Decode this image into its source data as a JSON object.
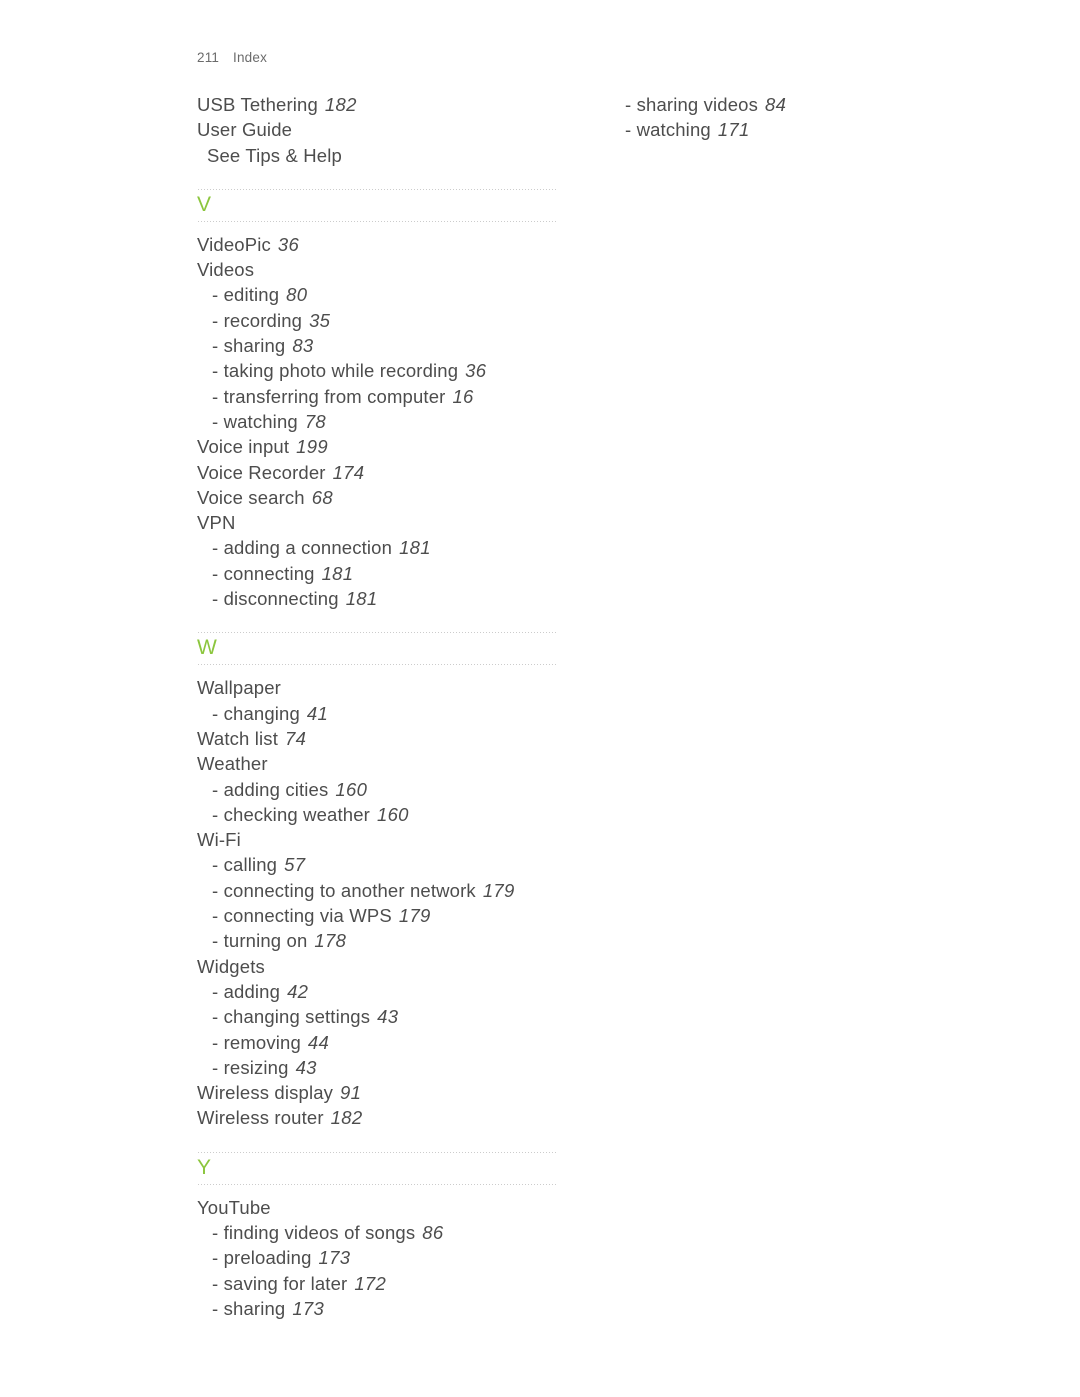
{
  "document": {
    "type": "index",
    "page_number": "211",
    "section_name": "Index",
    "accent_color": "#8cc63e",
    "text_color": "#4d4d4d",
    "background_color": "#ffffff"
  },
  "columns": [
    {
      "id": "left-column",
      "blocks": [
        {
          "kind": "entries",
          "entries": [
            {
              "level": 1,
              "term": "USB Tethering",
              "page": "182"
            },
            {
              "level": 1,
              "term": "User Guide",
              "page": ""
            },
            {
              "level": 1,
              "style": "xref",
              "term": "See Tips & Help",
              "page": ""
            }
          ]
        },
        {
          "kind": "alpha",
          "letter": "V"
        },
        {
          "kind": "entries",
          "entries": [
            {
              "level": 1,
              "term": "VideoPic",
              "page": "36"
            },
            {
              "level": 1,
              "term": "Videos",
              "page": ""
            },
            {
              "level": 2,
              "term": "- editing",
              "page": "80"
            },
            {
              "level": 2,
              "term": "- recording",
              "page": "35"
            },
            {
              "level": 2,
              "term": "- sharing",
              "page": "83"
            },
            {
              "level": 2,
              "term": "- taking photo while recording",
              "page": "36"
            },
            {
              "level": 2,
              "term": "- transferring from computer",
              "page": "16"
            },
            {
              "level": 2,
              "term": "- watching",
              "page": "78"
            },
            {
              "level": 1,
              "term": "Voice input",
              "page": "199"
            },
            {
              "level": 1,
              "term": "Voice Recorder",
              "page": "174"
            },
            {
              "level": 1,
              "term": "Voice search",
              "page": "68"
            },
            {
              "level": 1,
              "term": "VPN",
              "page": ""
            },
            {
              "level": 2,
              "term": "- adding a connection",
              "page": "181"
            },
            {
              "level": 2,
              "term": "- connecting",
              "page": "181"
            },
            {
              "level": 2,
              "term": "- disconnecting",
              "page": "181"
            }
          ]
        },
        {
          "kind": "alpha",
          "letter": "W"
        },
        {
          "kind": "entries",
          "entries": [
            {
              "level": 1,
              "term": "Wallpaper",
              "page": ""
            },
            {
              "level": 2,
              "term": "- changing",
              "page": "41"
            },
            {
              "level": 1,
              "term": "Watch list",
              "page": "74"
            },
            {
              "level": 1,
              "term": "Weather",
              "page": ""
            },
            {
              "level": 2,
              "term": "- adding cities",
              "page": "160"
            },
            {
              "level": 2,
              "term": "- checking weather",
              "page": "160"
            },
            {
              "level": 1,
              "term": "Wi-Fi",
              "page": ""
            },
            {
              "level": 2,
              "term": "- calling",
              "page": "57"
            },
            {
              "level": 2,
              "term": "- connecting to another network",
              "page": "179"
            },
            {
              "level": 2,
              "term": "- connecting via WPS",
              "page": "179"
            },
            {
              "level": 2,
              "term": "- turning on",
              "page": "178"
            },
            {
              "level": 1,
              "term": "Widgets",
              "page": ""
            },
            {
              "level": 2,
              "term": "- adding",
              "page": "42"
            },
            {
              "level": 2,
              "term": "- changing settings",
              "page": "43"
            },
            {
              "level": 2,
              "term": "- removing",
              "page": "44"
            },
            {
              "level": 2,
              "term": "- resizing",
              "page": "43"
            },
            {
              "level": 1,
              "term": "Wireless display",
              "page": "91"
            },
            {
              "level": 1,
              "term": "Wireless router",
              "page": "182"
            }
          ]
        },
        {
          "kind": "alpha",
          "letter": "Y"
        },
        {
          "kind": "entries",
          "entries": [
            {
              "level": 1,
              "term": "YouTube",
              "page": ""
            },
            {
              "level": 2,
              "term": "- finding videos of songs",
              "page": "86"
            },
            {
              "level": 2,
              "term": "- preloading",
              "page": "173"
            },
            {
              "level": 2,
              "term": "- saving for later",
              "page": "172"
            },
            {
              "level": 2,
              "term": "- sharing",
              "page": "173"
            }
          ]
        }
      ]
    },
    {
      "id": "right-column",
      "blocks": [
        {
          "kind": "entries",
          "entries": [
            {
              "level": 2,
              "term": "- sharing videos",
              "page": "84"
            },
            {
              "level": 2,
              "term": "- watching",
              "page": "171"
            }
          ]
        }
      ]
    }
  ]
}
